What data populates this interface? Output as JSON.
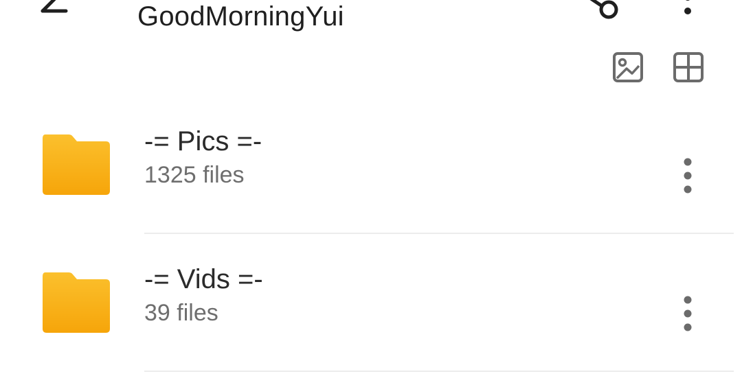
{
  "header": {
    "title": "GoodMorningYui",
    "back_icon": "arrow-back-icon",
    "share_icon": "share-icon",
    "overflow_icon": "more-vert-icon"
  },
  "view_toggles": {
    "gallery_icon": "image-icon",
    "grid_icon": "grid-view-icon"
  },
  "folders": [
    {
      "name": "-= Pics =-",
      "count": "1325 files"
    },
    {
      "name": "-= Vids =-",
      "count": "39 files"
    }
  ],
  "colors": {
    "folder_top": "#FBC02D",
    "folder_bottom": "#F6A50A",
    "icon_gray": "#6b6b6b",
    "text_primary": "#1f1f1f",
    "text_secondary": "#6e6e6e"
  }
}
